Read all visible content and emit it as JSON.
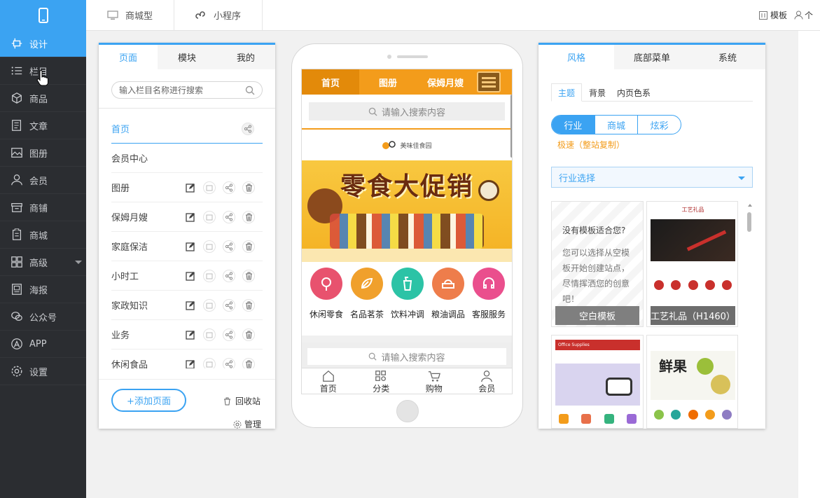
{
  "sidebar": {
    "items": [
      {
        "label": "设计",
        "icon": "design-icon"
      },
      {
        "label": "栏目",
        "icon": "list-icon"
      },
      {
        "label": "商品",
        "icon": "cube-icon"
      },
      {
        "label": "文章",
        "icon": "article-icon"
      },
      {
        "label": "图册",
        "icon": "image-icon"
      },
      {
        "label": "会员",
        "icon": "user-icon"
      },
      {
        "label": "商铺",
        "icon": "shop-icon"
      },
      {
        "label": "商城",
        "icon": "mall-icon"
      },
      {
        "label": "高级",
        "icon": "grid-icon"
      },
      {
        "label": "海报",
        "icon": "poster-icon"
      },
      {
        "label": "公众号",
        "icon": "wechat-icon"
      },
      {
        "label": "APP",
        "icon": "app-icon"
      },
      {
        "label": "设置",
        "icon": "gear-icon"
      }
    ]
  },
  "topbar": {
    "tab1": "商城型",
    "tab2": "小程序",
    "template": "模板",
    "user": "个"
  },
  "pages_panel": {
    "tabs": [
      "页面",
      "模块",
      "我的"
    ],
    "search_placeholder": "输入栏目名称进行搜索",
    "pages": [
      "首页",
      "会员中心",
      "图册",
      "保姆月嫂",
      "家庭保洁",
      "小时工",
      "家政知识",
      "业务",
      "休闲食品"
    ],
    "add_button": "+添加页面",
    "recycle": "回收站",
    "manage": "管理"
  },
  "phone": {
    "nav": [
      "首页",
      "图册",
      "保姆月嫂"
    ],
    "search_placeholder": "请输入搜索内容",
    "logo_text": "美味佳食园",
    "banner_text": "零食大促销",
    "categories": [
      {
        "label": "休闲零食",
        "color": "#e8526e"
      },
      {
        "label": "名品茗茶",
        "color": "#f0a02c"
      },
      {
        "label": "饮料冲调",
        "color": "#2cc3a6"
      },
      {
        "label": "粮油调品",
        "color": "#ee7d4b"
      },
      {
        "label": "客服服务",
        "color": "#ea4f8d"
      }
    ],
    "search2": "请输入搜索内容",
    "bottom_nav": [
      "首页",
      "分类",
      "购物",
      "会员"
    ]
  },
  "style_panel": {
    "tabs": [
      "风格",
      "底部菜单",
      "系统"
    ],
    "subtabs": [
      "主题",
      "背景",
      "内页色系"
    ],
    "segments": [
      "行业",
      "商城",
      "炫彩"
    ],
    "speed_link": "极速（整站复制）",
    "industry_select": "行业选择",
    "blank_card": {
      "title": "没有模板适合您?",
      "body": "您可以选择从空模板开始创建站点，尽情挥洒您的创意吧！",
      "label": "空白模板"
    },
    "template1_label": "工艺礼品（H1460）",
    "template1_brand": "工艺礼品",
    "template3_brand": "Office Supplies",
    "template4_text": "鲜果"
  },
  "colors": {
    "accent": "#3ba3f2",
    "sidebar_bg": "#2b2d31",
    "orange": "#f39c1b"
  }
}
